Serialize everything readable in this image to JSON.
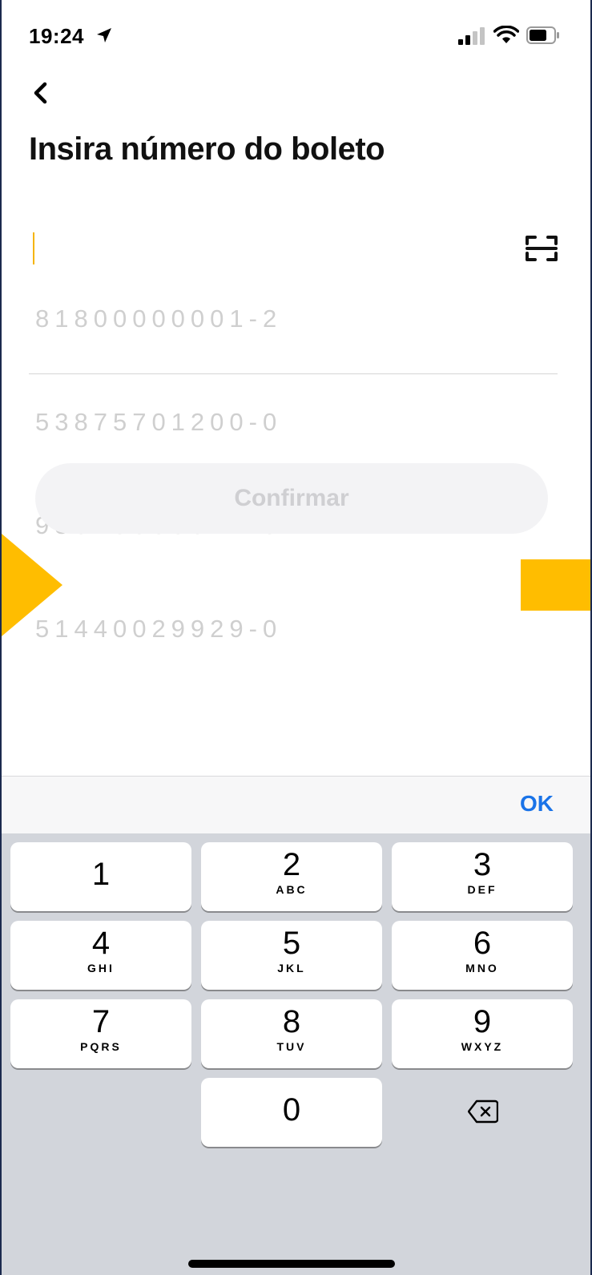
{
  "status_bar": {
    "time": "19:24",
    "icons": [
      "location-arrow-icon",
      "signal-icon",
      "wifi-icon",
      "battery-icon"
    ]
  },
  "nav": {
    "back_icon": "chevron-left-icon"
  },
  "page": {
    "title": "Insira número do boleto"
  },
  "boleto_input": {
    "placeholder_lines": [
      "81800000001-2",
      "53875701200-0",
      "93010000074-3",
      "51440029929-0"
    ],
    "value": "",
    "scan_icon": "barcode-scan-icon"
  },
  "confirm_button": {
    "label": "Confirmar",
    "enabled": false
  },
  "keyboard": {
    "accessory": {
      "ok_label": "OK"
    },
    "keys": [
      {
        "digit": "1",
        "letters": ""
      },
      {
        "digit": "2",
        "letters": "ABC"
      },
      {
        "digit": "3",
        "letters": "DEF"
      },
      {
        "digit": "4",
        "letters": "GHI"
      },
      {
        "digit": "5",
        "letters": "JKL"
      },
      {
        "digit": "6",
        "letters": "MNO"
      },
      {
        "digit": "7",
        "letters": "PQRS"
      },
      {
        "digit": "8",
        "letters": "TUV"
      },
      {
        "digit": "9",
        "letters": "WXYZ"
      },
      {
        "digit": "0",
        "letters": ""
      }
    ],
    "backspace_icon": "backspace-icon"
  },
  "colors": {
    "accent_arrow": "#ffbd00",
    "ok_blue": "#1a73e8",
    "keyboard_bg": "#d2d5db",
    "frame": "#1b2a4e"
  }
}
